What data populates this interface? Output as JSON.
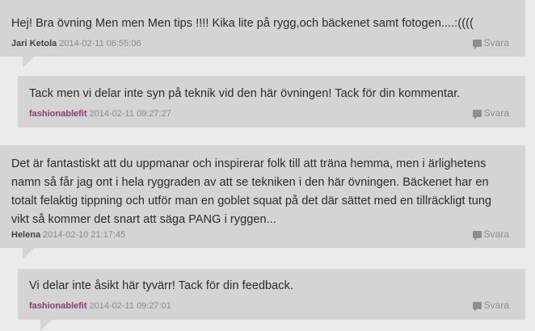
{
  "comments": [
    {
      "text": "Hej! Bra övning Men men Men tips !!!! Kika lite på rygg,och bäckenet samt fotogen....:((((",
      "author": "Jari Ketola",
      "date": "2014-02-11 06:55:06",
      "reply_label": "Svara"
    },
    {
      "text": "Tack men vi delar inte syn på teknik vid den här övningen! Tack för din kommentar.",
      "author": "fashionablefit",
      "date": "2014-02-11 09:27:27",
      "reply_label": "Svara"
    },
    {
      "text": "Det är fantastiskt att du uppmanar och inspirerar folk till att träna hemma, men i ärlighetens namn så får jag ont i hela ryggraden av att se tekniken i den här övningen. Bäckenet har en totalt felaktig tippning och utför man en goblet squat på det där sättet med en tillräckligt tung vikt så kommer det snart att säga PANG i ryggen...",
      "author": "Helena",
      "date": "2014-02-10 21:17:45",
      "reply_label": "Svara"
    },
    {
      "text": "Vi delar inte åsikt här tyvärr! Tack för din feedback.",
      "author": "fashionablefit",
      "date": "2014-02-11 09:27:01",
      "reply_label": "Svara"
    }
  ],
  "icons": {
    "reply": "speech-bubble-icon"
  },
  "colors": {
    "background": "#ebebeb",
    "comment_box": "#d4d4d4",
    "text": "#2b2b2b",
    "author": "#444444",
    "author_admin": "#8a3a78",
    "meta": "#8a8a8a"
  }
}
